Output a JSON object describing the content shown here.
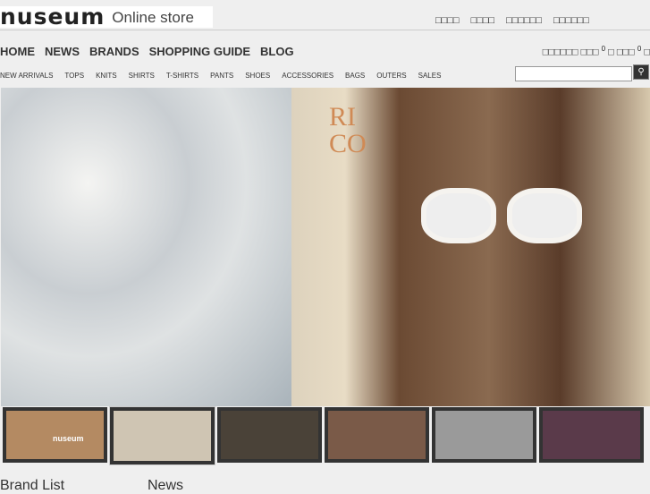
{
  "logo": {
    "mark": "nuseum",
    "sub": "Online store"
  },
  "top_links": [
    "□□□□",
    "□□□□",
    "□□□□□□",
    "□□□□□□"
  ],
  "main_nav": [
    "HOME",
    "NEWS",
    "BRANDS",
    "SHOPPING GUIDE",
    "BLOG"
  ],
  "cart": {
    "label": "□□□□□□ □□□",
    "count1": "0",
    "mid": "□ □□□",
    "count2": "0",
    "end": "□"
  },
  "sub_nav": [
    "NEW ARRIVALS",
    "TOPS",
    "KNITS",
    "SHIRTS",
    "T-SHIRTS",
    "PANTS",
    "SHOES",
    "ACCESSORIES",
    "BAGS",
    "OUTERS",
    "SALES"
  ],
  "search": {
    "value": "",
    "button_icon": "search-icon"
  },
  "hero": {
    "text": "RI CO"
  },
  "thumbnails": [
    {
      "bg": "#b48a62",
      "label": "nuseum"
    },
    {
      "bg": "#cfc5b3"
    },
    {
      "bg": "#4a4238"
    },
    {
      "bg": "#7a5a48"
    },
    {
      "bg": "#9a9a9a"
    },
    {
      "bg": "#5a3a4a"
    }
  ],
  "sections": {
    "brand_list": "Brand List",
    "news": "News"
  }
}
